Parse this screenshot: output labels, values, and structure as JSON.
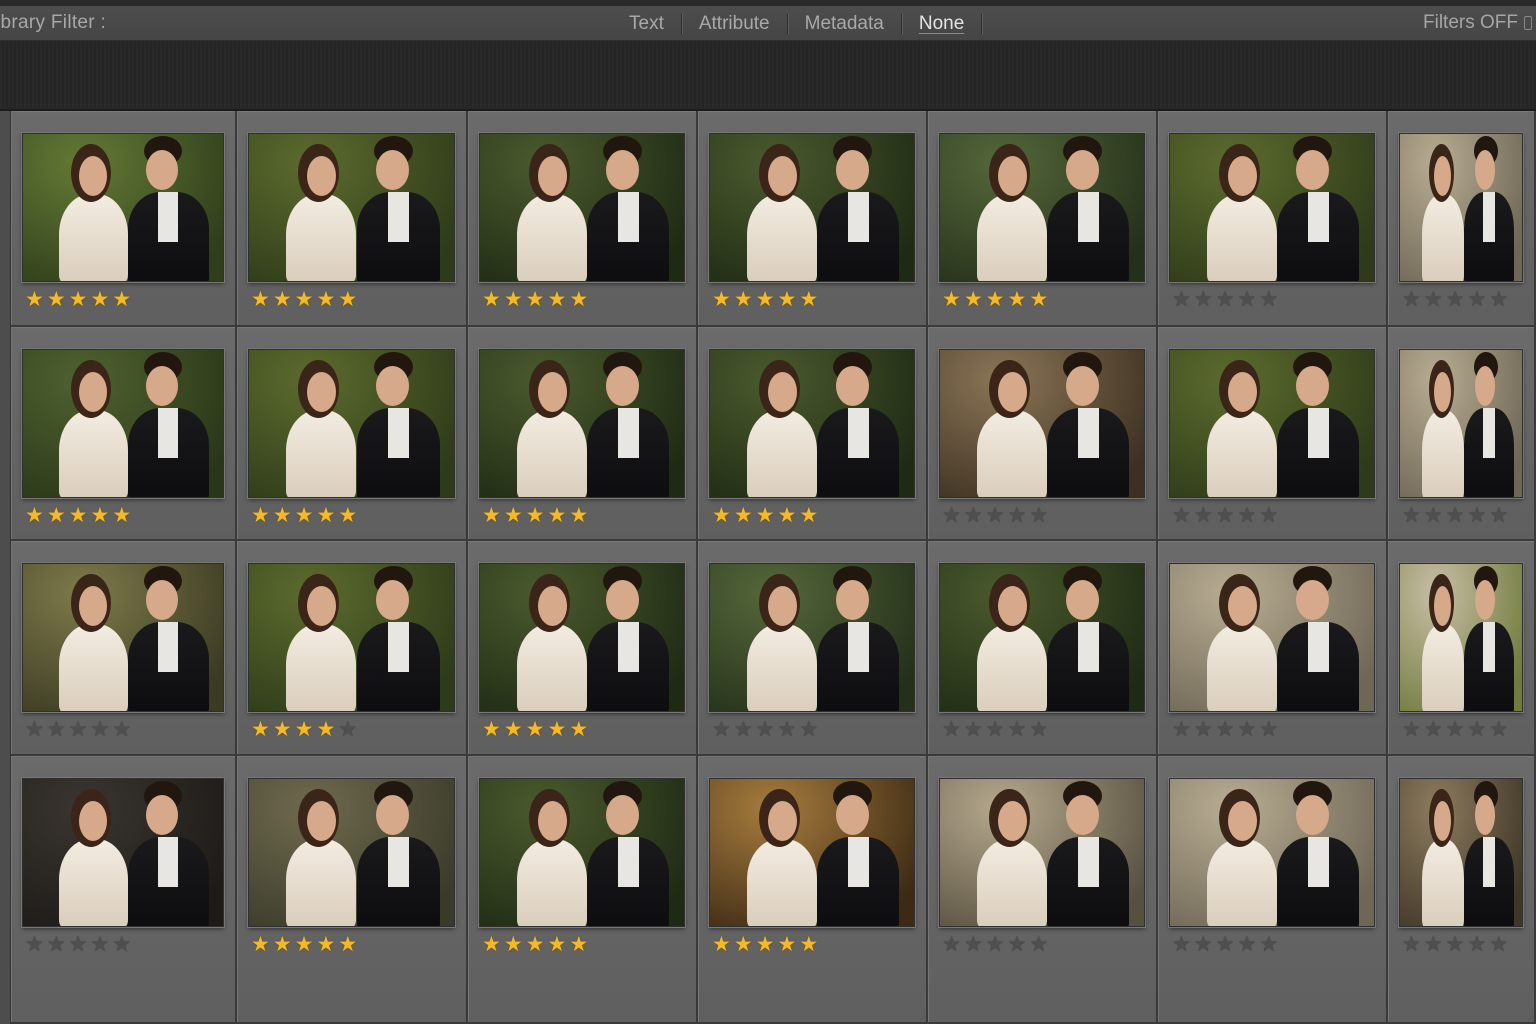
{
  "filter_bar": {
    "title": "ibrary Filter :",
    "tabs": [
      "Text",
      "Attribute",
      "Metadata",
      "None"
    ],
    "active_tab": "None",
    "filters_status": "Filters OFF"
  },
  "colors": {
    "star_on": "#f2b92a",
    "star_off": "#4f4f4f",
    "cell_bg": "#666666",
    "panel_bg": "#262626"
  },
  "icons": {
    "star": "★",
    "lock": "lock-icon"
  },
  "grid": {
    "columns": 7,
    "rows": 4,
    "photos": [
      {
        "rating": 5,
        "scene": "park-veil"
      },
      {
        "rating": 5,
        "scene": "park"
      },
      {
        "rating": 5,
        "scene": "garden"
      },
      {
        "rating": 5,
        "scene": "garden"
      },
      {
        "rating": 5,
        "scene": "garden-veil"
      },
      {
        "rating": 0,
        "scene": "park"
      },
      {
        "rating": 0,
        "scene": "house"
      },
      {
        "rating": 5,
        "scene": "lawn-walk"
      },
      {
        "rating": 5,
        "scene": "park"
      },
      {
        "rating": 5,
        "scene": "garden"
      },
      {
        "rating": 5,
        "scene": "garden"
      },
      {
        "rating": 0,
        "scene": "hall-group"
      },
      {
        "rating": 0,
        "scene": "park"
      },
      {
        "rating": 0,
        "scene": "house"
      },
      {
        "rating": 0,
        "scene": "forest-walk"
      },
      {
        "rating": 3.5,
        "scene": "park"
      },
      {
        "rating": 5,
        "scene": "garden"
      },
      {
        "rating": 0,
        "scene": "garden-veil"
      },
      {
        "rating": 0,
        "scene": "garden"
      },
      {
        "rating": 0,
        "scene": "house"
      },
      {
        "rating": 0,
        "scene": "house-single"
      },
      {
        "rating": 0,
        "scene": "closeup"
      },
      {
        "rating": 5,
        "scene": "drive-walk"
      },
      {
        "rating": 5,
        "scene": "garden"
      },
      {
        "rating": 5,
        "scene": "sunset"
      },
      {
        "rating": 0,
        "scene": "hall-walk"
      },
      {
        "rating": 0,
        "scene": "house"
      },
      {
        "rating": 0,
        "scene": "house-walk"
      }
    ]
  }
}
